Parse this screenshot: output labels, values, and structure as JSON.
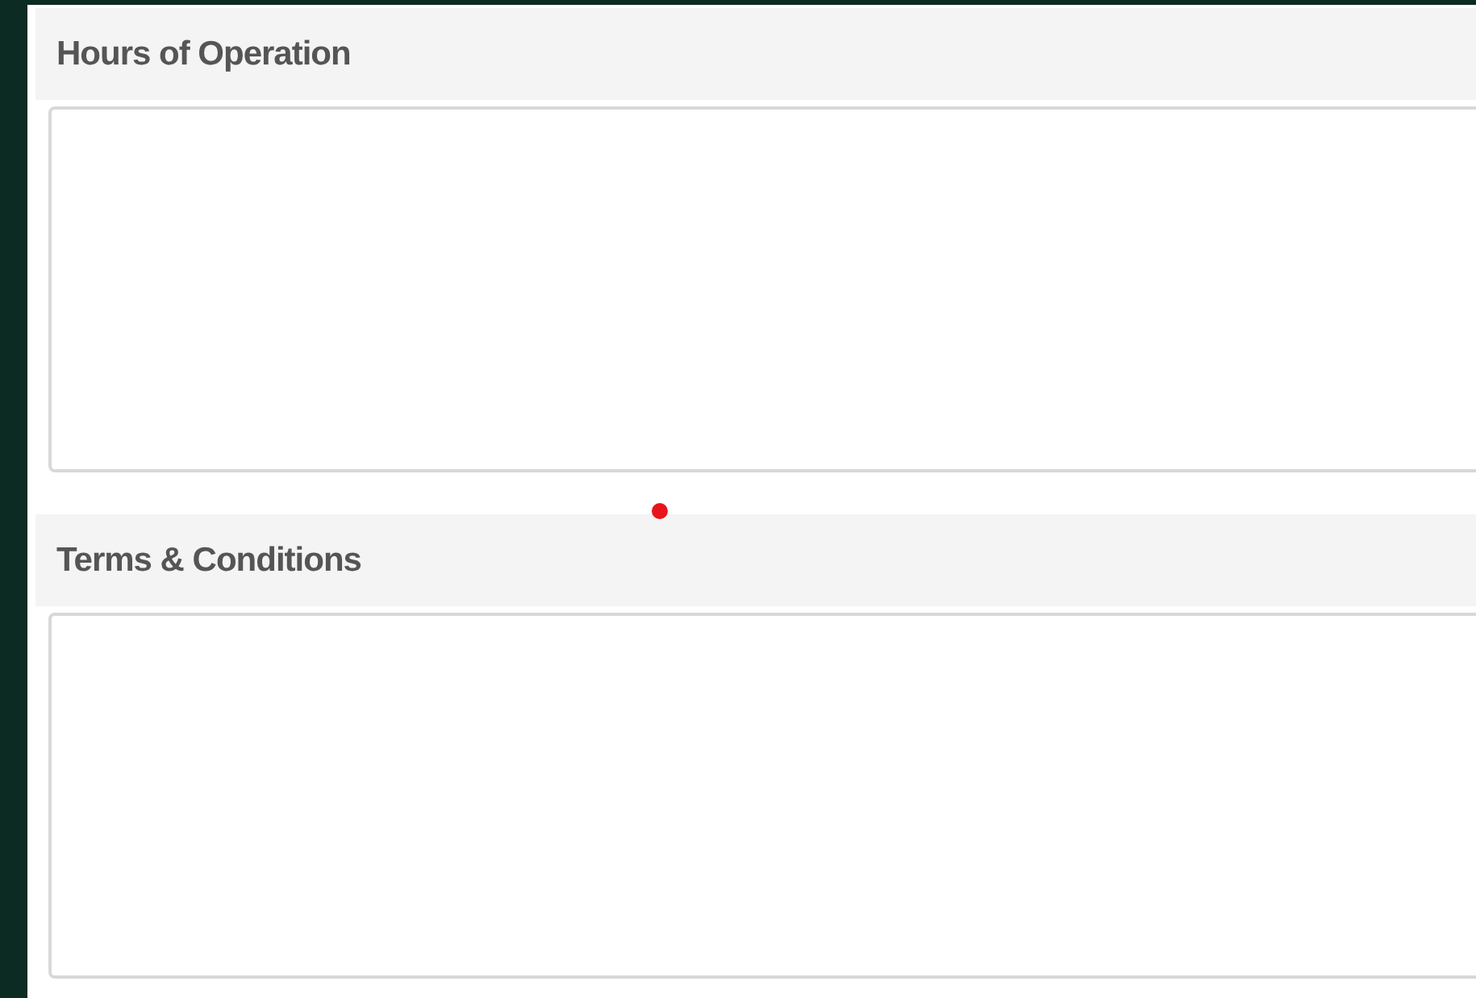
{
  "sections": [
    {
      "title": "Hours of Operation",
      "marker": false
    },
    {
      "title": "Terms & Conditions",
      "marker": true
    }
  ]
}
